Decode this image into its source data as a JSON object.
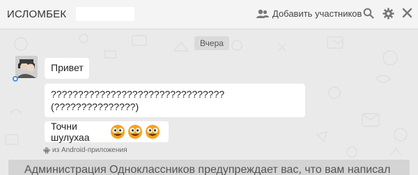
{
  "header": {
    "chat_title": "ИСЛОМБЕК",
    "add_members_label": "Добавить участников"
  },
  "chat": {
    "date_separator": "Вчера",
    "messages": [
      {
        "text": "Привет"
      },
      {
        "line1": "????????????????????????????????",
        "line2": "(???????????????)"
      },
      {
        "text": "Точни шулухаа"
      }
    ],
    "source_label": "из Android-приложения",
    "warning_text": "Администрация Одноклассников предупреждает вас, что вам написал"
  },
  "colors": {
    "accent": "#4a8fe2",
    "smiley": "#f4a21e"
  },
  "icons": [
    "add-user-icon",
    "search-icon",
    "gear-icon",
    "close-icon",
    "android-icon",
    "smiley-icon"
  ]
}
